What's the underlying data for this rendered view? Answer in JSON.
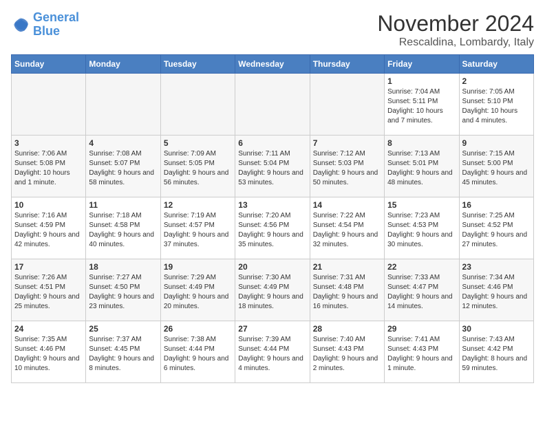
{
  "logo": {
    "line1": "General",
    "line2": "Blue"
  },
  "title": "November 2024",
  "location": "Rescaldina, Lombardy, Italy",
  "weekdays": [
    "Sunday",
    "Monday",
    "Tuesday",
    "Wednesday",
    "Thursday",
    "Friday",
    "Saturday"
  ],
  "weeks": [
    [
      {
        "day": "",
        "info": ""
      },
      {
        "day": "",
        "info": ""
      },
      {
        "day": "",
        "info": ""
      },
      {
        "day": "",
        "info": ""
      },
      {
        "day": "",
        "info": ""
      },
      {
        "day": "1",
        "info": "Sunrise: 7:04 AM\nSunset: 5:11 PM\nDaylight: 10 hours and 7 minutes."
      },
      {
        "day": "2",
        "info": "Sunrise: 7:05 AM\nSunset: 5:10 PM\nDaylight: 10 hours and 4 minutes."
      }
    ],
    [
      {
        "day": "3",
        "info": "Sunrise: 7:06 AM\nSunset: 5:08 PM\nDaylight: 10 hours and 1 minute."
      },
      {
        "day": "4",
        "info": "Sunrise: 7:08 AM\nSunset: 5:07 PM\nDaylight: 9 hours and 58 minutes."
      },
      {
        "day": "5",
        "info": "Sunrise: 7:09 AM\nSunset: 5:05 PM\nDaylight: 9 hours and 56 minutes."
      },
      {
        "day": "6",
        "info": "Sunrise: 7:11 AM\nSunset: 5:04 PM\nDaylight: 9 hours and 53 minutes."
      },
      {
        "day": "7",
        "info": "Sunrise: 7:12 AM\nSunset: 5:03 PM\nDaylight: 9 hours and 50 minutes."
      },
      {
        "day": "8",
        "info": "Sunrise: 7:13 AM\nSunset: 5:01 PM\nDaylight: 9 hours and 48 minutes."
      },
      {
        "day": "9",
        "info": "Sunrise: 7:15 AM\nSunset: 5:00 PM\nDaylight: 9 hours and 45 minutes."
      }
    ],
    [
      {
        "day": "10",
        "info": "Sunrise: 7:16 AM\nSunset: 4:59 PM\nDaylight: 9 hours and 42 minutes."
      },
      {
        "day": "11",
        "info": "Sunrise: 7:18 AM\nSunset: 4:58 PM\nDaylight: 9 hours and 40 minutes."
      },
      {
        "day": "12",
        "info": "Sunrise: 7:19 AM\nSunset: 4:57 PM\nDaylight: 9 hours and 37 minutes."
      },
      {
        "day": "13",
        "info": "Sunrise: 7:20 AM\nSunset: 4:56 PM\nDaylight: 9 hours and 35 minutes."
      },
      {
        "day": "14",
        "info": "Sunrise: 7:22 AM\nSunset: 4:54 PM\nDaylight: 9 hours and 32 minutes."
      },
      {
        "day": "15",
        "info": "Sunrise: 7:23 AM\nSunset: 4:53 PM\nDaylight: 9 hours and 30 minutes."
      },
      {
        "day": "16",
        "info": "Sunrise: 7:25 AM\nSunset: 4:52 PM\nDaylight: 9 hours and 27 minutes."
      }
    ],
    [
      {
        "day": "17",
        "info": "Sunrise: 7:26 AM\nSunset: 4:51 PM\nDaylight: 9 hours and 25 minutes."
      },
      {
        "day": "18",
        "info": "Sunrise: 7:27 AM\nSunset: 4:50 PM\nDaylight: 9 hours and 23 minutes."
      },
      {
        "day": "19",
        "info": "Sunrise: 7:29 AM\nSunset: 4:49 PM\nDaylight: 9 hours and 20 minutes."
      },
      {
        "day": "20",
        "info": "Sunrise: 7:30 AM\nSunset: 4:49 PM\nDaylight: 9 hours and 18 minutes."
      },
      {
        "day": "21",
        "info": "Sunrise: 7:31 AM\nSunset: 4:48 PM\nDaylight: 9 hours and 16 minutes."
      },
      {
        "day": "22",
        "info": "Sunrise: 7:33 AM\nSunset: 4:47 PM\nDaylight: 9 hours and 14 minutes."
      },
      {
        "day": "23",
        "info": "Sunrise: 7:34 AM\nSunset: 4:46 PM\nDaylight: 9 hours and 12 minutes."
      }
    ],
    [
      {
        "day": "24",
        "info": "Sunrise: 7:35 AM\nSunset: 4:46 PM\nDaylight: 9 hours and 10 minutes."
      },
      {
        "day": "25",
        "info": "Sunrise: 7:37 AM\nSunset: 4:45 PM\nDaylight: 9 hours and 8 minutes."
      },
      {
        "day": "26",
        "info": "Sunrise: 7:38 AM\nSunset: 4:44 PM\nDaylight: 9 hours and 6 minutes."
      },
      {
        "day": "27",
        "info": "Sunrise: 7:39 AM\nSunset: 4:44 PM\nDaylight: 9 hours and 4 minutes."
      },
      {
        "day": "28",
        "info": "Sunrise: 7:40 AM\nSunset: 4:43 PM\nDaylight: 9 hours and 2 minutes."
      },
      {
        "day": "29",
        "info": "Sunrise: 7:41 AM\nSunset: 4:43 PM\nDaylight: 9 hours and 1 minute."
      },
      {
        "day": "30",
        "info": "Sunrise: 7:43 AM\nSunset: 4:42 PM\nDaylight: 8 hours and 59 minutes."
      }
    ]
  ]
}
